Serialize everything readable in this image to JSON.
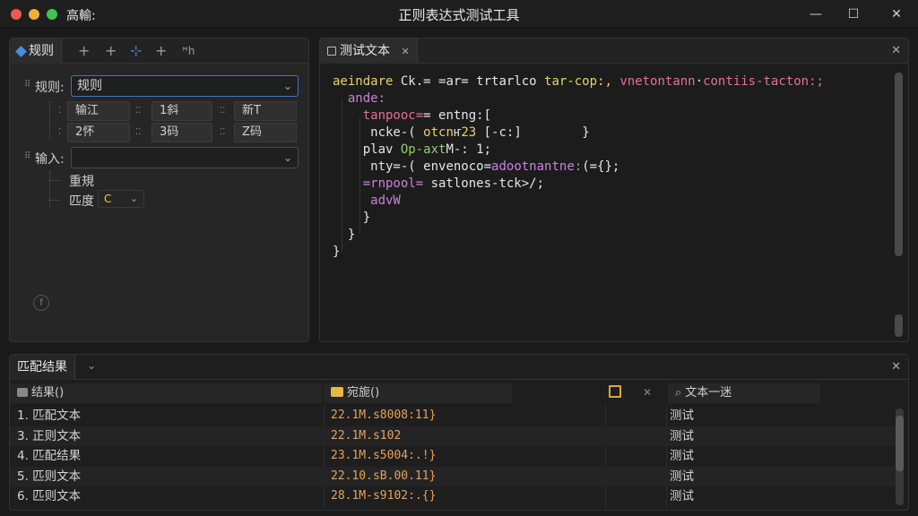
{
  "window": {
    "app_name": "高輸:",
    "title": "正则表达式测试工具",
    "minimize": "—",
    "maximize": "☐",
    "close": "✕"
  },
  "rules_panel": {
    "tab_label": "规则",
    "tools": [
      "+",
      "+",
      "⊹",
      "+",
      "ꟸh"
    ],
    "rule_label": "规则:",
    "rule_value": "规则",
    "grid": [
      [
        "输江",
        "1斜",
        "新T"
      ],
      [
        "2怀",
        "3码",
        "Z码"
      ]
    ],
    "input_label": "输入:",
    "input_value": "",
    "option_1": "重規",
    "option_2": "匹度",
    "option_2_value": "C",
    "footer_icon": "f"
  },
  "test_panel": {
    "tab_label": "测试文本",
    "close": "✕",
    "lines": [
      [
        {
          "t": "aeindare ",
          "c": "c-y"
        },
        {
          "t": "Ck.= ",
          "c": "c-w"
        },
        {
          "t": "=ar= ",
          "c": "c-w"
        },
        {
          "t": "trtarlco ",
          "c": "c-w"
        },
        {
          "t": "tar-cop:,",
          "c": "c-y"
        },
        {
          "t": " ",
          "c": "c-w"
        },
        {
          "t": "vnetontann",
          "c": "c-pk"
        },
        {
          "t": "·",
          "c": "c-w"
        },
        {
          "t": "contiis-tacton:;",
          "c": "c-pk"
        }
      ],
      [
        {
          "t": "  ande:",
          "c": "c-p"
        }
      ],
      [
        {
          "t": "    tanpooc=",
          "c": "c-pk"
        },
        {
          "t": "= ",
          "c": "c-w"
        },
        {
          "t": "entng:[",
          "c": "c-w"
        }
      ],
      [
        {
          "t": "     ncke-( ",
          "c": "c-w"
        },
        {
          "t": "otcn",
          "c": "c-y"
        },
        {
          "t": "ҥ",
          "c": "c-w"
        },
        {
          "t": "23 ",
          "c": "c-y"
        },
        {
          "t": "[-c:]",
          "c": "c-w"
        },
        {
          "t": "        }",
          "c": "c-w"
        }
      ],
      [
        {
          "t": "    plav ",
          "c": "c-w"
        },
        {
          "t": "Op-axt",
          "c": "c-g"
        },
        {
          "t": "M-: 1;",
          "c": "c-w"
        }
      ],
      [
        {
          "t": "     nty=-( ",
          "c": "c-w"
        },
        {
          "t": "envenoco",
          "c": "c-w"
        },
        {
          "t": "=",
          "c": "c-w"
        },
        {
          "t": "adootnantne:",
          "c": "c-p"
        },
        {
          "t": "(={}",
          "c": "c-w"
        },
        {
          "t": ";",
          "c": "c-w"
        }
      ],
      [
        {
          "t": "    =rnpool= ",
          "c": "c-p"
        },
        {
          "t": "satlones-",
          "c": "c-w"
        },
        {
          "t": "tck>",
          "c": "c-w"
        },
        {
          "t": "/;",
          "c": "c-w"
        }
      ],
      [
        {
          "t": "     advW",
          "c": "c-p"
        }
      ],
      [
        {
          "t": "    }",
          "c": "c-w"
        }
      ],
      [
        {
          "t": "  }",
          "c": "c-w"
        }
      ],
      [
        {
          "t": "}",
          "c": "c-w"
        }
      ]
    ]
  },
  "results_panel": {
    "tab_label": "匹配结果",
    "close": "✕",
    "headers": {
      "result": "结果()",
      "position": "宛旎()",
      "text": "文本一迷",
      "clear": "✕"
    },
    "rows": [
      {
        "result": "1. 匹配文本",
        "position": "22.1M.s8008:11}",
        "text": "测试"
      },
      {
        "result": "3. 正则文本",
        "position": "22.1M.s102",
        "text": "测试"
      },
      {
        "result": "4. 匹配结果",
        "position": "23.1M.s5004:.!}",
        "text": "测试"
      },
      {
        "result": "5. 匹则文本",
        "position": "22.10.sB.00.11}",
        "text": "测试"
      },
      {
        "result": "6. 匹则文本",
        "position": "28.1M-s9102:.{}",
        "text": "测试"
      }
    ]
  }
}
